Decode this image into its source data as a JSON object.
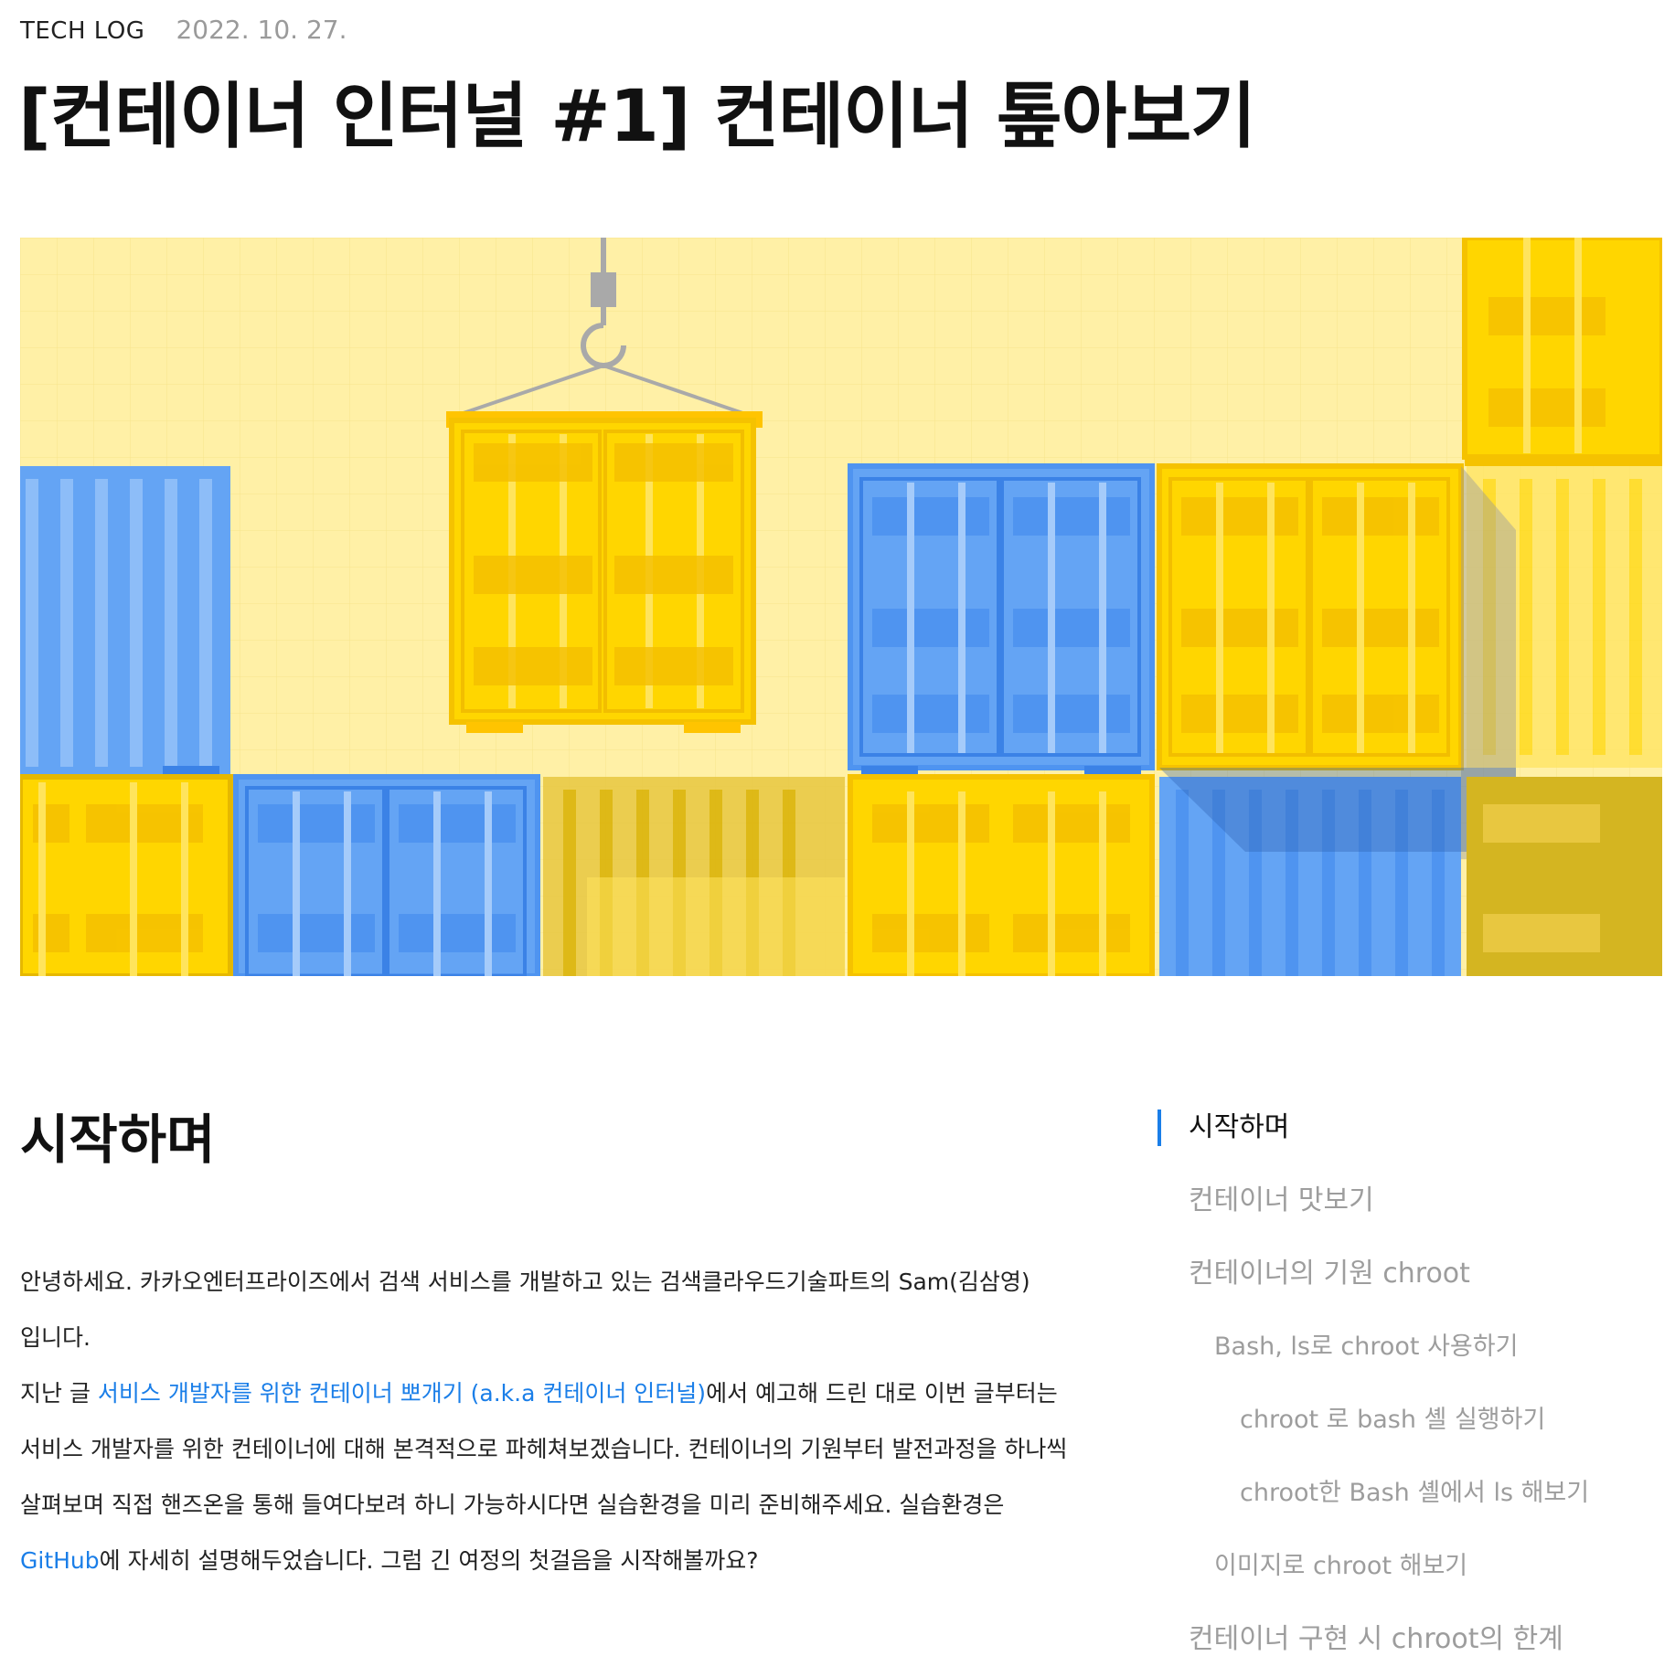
{
  "header": {
    "category": "TECH LOG",
    "date": "2022. 10. 27.",
    "title": "[컨테이너 인터널 #1] 컨테이너 톺아보기"
  },
  "hero": {
    "colors": {
      "background": "#fff0a6",
      "yellow": "#ffd600",
      "yellow_dark": "#f2c400",
      "yellow_light": "#ffe45c",
      "blue": "#64a4f4",
      "blue_light": "#8dbdf8",
      "blue_dark": "#3b82e6",
      "hook": "#a9a9a9"
    }
  },
  "article": {
    "section_title": "시작하며",
    "p1": "안녕하세요. 카카오엔터프라이즈에서 검색 서비스를 개발하고 있는 검색클라우드기술파트의 Sam(김삼영)입니다.",
    "p2_before": "지난 글 ",
    "p2_link": "서비스 개발자를 위한 컨테이너 뽀개기 (a.k.a 컨테이너 인터널)",
    "p2_mid": "에서 예고해 드린 대로 이번 글부터는 서비스 개발자를 위한 컨테이너에 대해 본격적으로 파헤쳐보겠습니다. 컨테이너의 기원부터 발전과정을 하나씩 살펴보며 직접 핸즈온을 통해 들여다보려 하니 가능하시다면 실습환경을 미리 준비해주세요. 실습환경은 ",
    "p2_link2": "GitHub",
    "p2_after": "에 자세히 설명해두었습니다. 그럼 긴 여정의 첫걸음을 시작해볼까요?"
  },
  "toc": {
    "items": [
      {
        "label": "시작하며"
      },
      {
        "label": "컨테이너 맛보기"
      },
      {
        "label": "컨테이너의 기원 chroot"
      },
      {
        "label": "Bash, ls로 chroot 사용하기"
      },
      {
        "label": "chroot 로 bash 셸 실행하기"
      },
      {
        "label": "chroot한 Bash 셸에서 ls 해보기"
      },
      {
        "label": "이미지로 chroot 해보기"
      },
      {
        "label": "컨테이너 구현 시 chroot의 한계"
      }
    ]
  }
}
